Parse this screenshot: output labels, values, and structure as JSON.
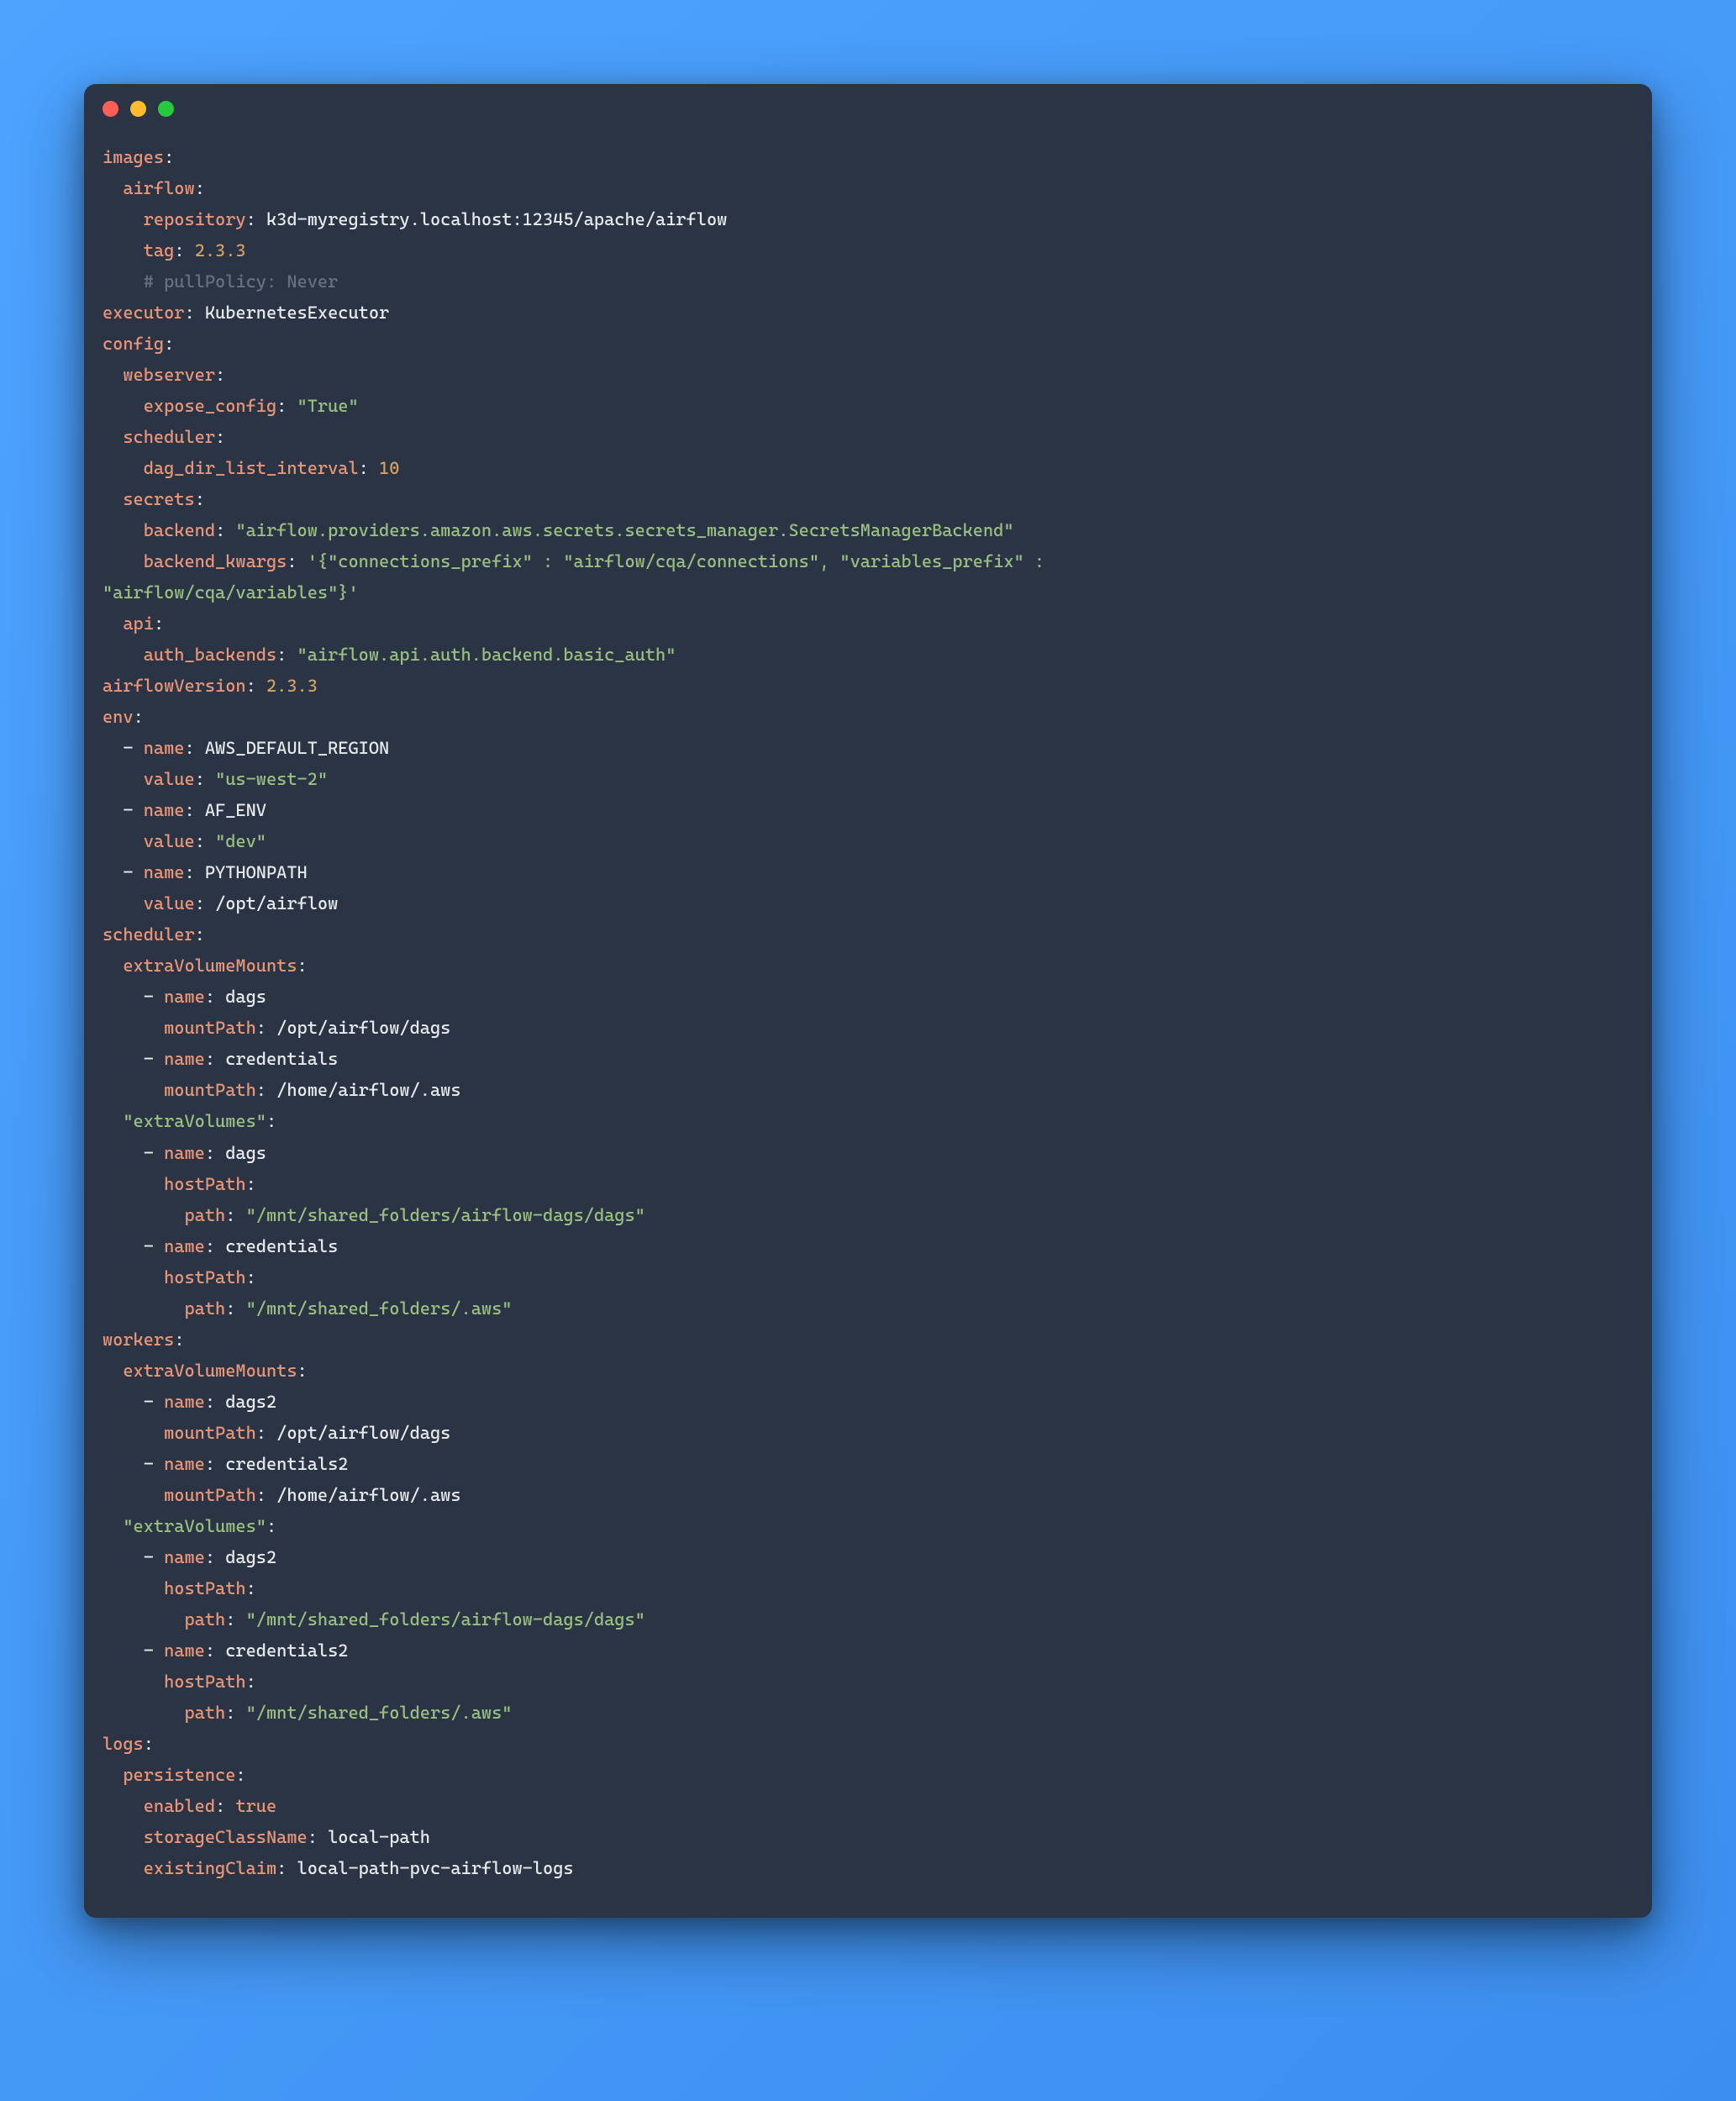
{
  "code": {
    "images": {
      "key": "images",
      "airflow": {
        "key": "airflow",
        "repository_key": "repository",
        "repository_val": "k3d-myregistry.localhost:12345/apache/airflow",
        "tag_key": "tag",
        "tag_val": "2.3.3",
        "comment": "# pullPolicy: Never"
      }
    },
    "executor_key": "executor",
    "executor_val": "KubernetesExecutor",
    "config": {
      "key": "config",
      "webserver": {
        "key": "webserver",
        "expose_config_key": "expose_config",
        "expose_config_val": "\"True\""
      },
      "scheduler": {
        "key": "scheduler",
        "dag_dir_key": "dag_dir_list_interval",
        "dag_dir_val": "10"
      },
      "secrets": {
        "key": "secrets",
        "backend_key": "backend",
        "backend_val": "\"airflow.providers.amazon.aws.secrets.secrets_manager.SecretsManagerBackend\"",
        "backend_kwargs_key": "backend_kwargs",
        "backend_kwargs_val": "'{\"connections_prefix\" : \"airflow/cqa/connections\", \"variables_prefix\" : ",
        "backend_kwargs_val2": "\"airflow/cqa/variables\"}'"
      },
      "api": {
        "key": "api",
        "auth_key": "auth_backends",
        "auth_val": "\"airflow.api.auth.backend.basic_auth\""
      }
    },
    "airflowVersion_key": "airflowVersion",
    "airflowVersion_val": "2.3.3",
    "env": {
      "key": "env",
      "items": [
        {
          "name_key": "name",
          "name_val": "AWS_DEFAULT_REGION",
          "value_key": "value",
          "value_val": "\"us-west-2\""
        },
        {
          "name_key": "name",
          "name_val": "AF_ENV",
          "value_key": "value",
          "value_val": "\"dev\""
        },
        {
          "name_key": "name",
          "name_val": "PYTHONPATH",
          "value_key": "value",
          "value_val": "/opt/airflow"
        }
      ]
    },
    "scheduler": {
      "key": "scheduler",
      "extraVolumeMounts_key": "extraVolumeMounts",
      "mounts": [
        {
          "name_key": "name",
          "name_val": "dags",
          "mount_key": "mountPath",
          "mount_val": "/opt/airflow/dags"
        },
        {
          "name_key": "name",
          "name_val": "credentials",
          "mount_key": "mountPath",
          "mount_val": "/home/airflow/.aws"
        }
      ],
      "extraVolumes_key": "\"extraVolumes\"",
      "volumes": [
        {
          "name_key": "name",
          "name_val": "dags",
          "host_key": "hostPath",
          "path_key": "path",
          "path_val": "\"/mnt/shared_folders/airflow-dags/dags\""
        },
        {
          "name_key": "name",
          "name_val": "credentials",
          "host_key": "hostPath",
          "path_key": "path",
          "path_val": "\"/mnt/shared_folders/.aws\""
        }
      ]
    },
    "workers": {
      "key": "workers",
      "extraVolumeMounts_key": "extraVolumeMounts",
      "mounts": [
        {
          "name_key": "name",
          "name_val": "dags2",
          "mount_key": "mountPath",
          "mount_val": "/opt/airflow/dags"
        },
        {
          "name_key": "name",
          "name_val": "credentials2",
          "mount_key": "mountPath",
          "mount_val": "/home/airflow/.aws"
        }
      ],
      "extraVolumes_key": "\"extraVolumes\"",
      "volumes": [
        {
          "name_key": "name",
          "name_val": "dags2",
          "host_key": "hostPath",
          "path_key": "path",
          "path_val": "\"/mnt/shared_folders/airflow-dags/dags\""
        },
        {
          "name_key": "name",
          "name_val": "credentials2",
          "host_key": "hostPath",
          "path_key": "path",
          "path_val": "\"/mnt/shared_folders/.aws\""
        }
      ]
    },
    "logs": {
      "key": "logs",
      "persistence_key": "persistence",
      "enabled_key": "enabled",
      "enabled_val": "true",
      "storageClassName_key": "storageClassName",
      "storageClassName_val": "local-path",
      "existingClaim_key": "existingClaim",
      "existingClaim_val": "local-path-pvc-airflow-logs"
    }
  }
}
